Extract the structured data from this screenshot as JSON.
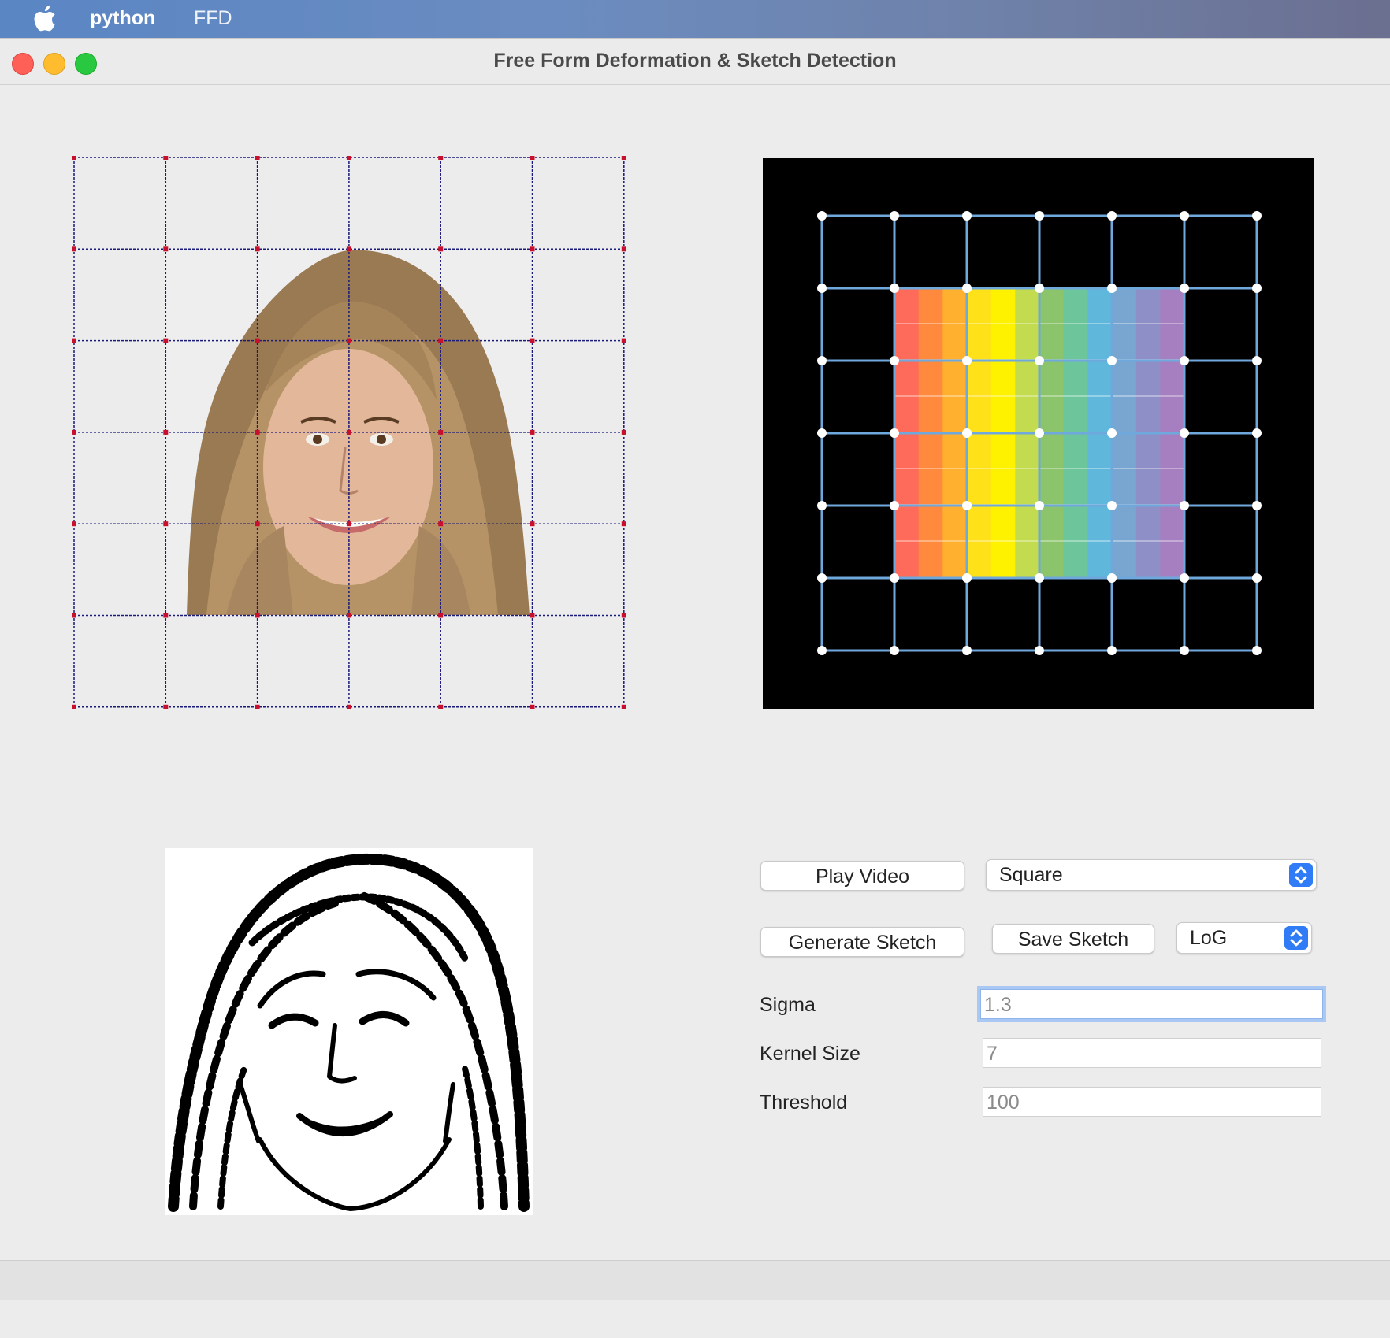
{
  "menubar": {
    "app_name": "python",
    "menu_item": "FFD"
  },
  "window": {
    "title": "Free Form Deformation & Sketch Detection"
  },
  "controls": {
    "play_video_label": "Play Video",
    "shape_select_value": "Square",
    "generate_sketch_label": "Generate Sketch",
    "save_sketch_label": "Save Sketch",
    "method_select_value": "LoG",
    "sigma": {
      "label": "Sigma",
      "placeholder": "1.3"
    },
    "kernel_size": {
      "label": "Kernel Size",
      "placeholder": "7"
    },
    "threshold": {
      "label": "Threshold",
      "placeholder": "100"
    }
  },
  "colors": {
    "ffd_grid_line": "#1a1a7a",
    "ffd_control_point": "#c8102e",
    "color_grid_line": "#6fa8dc",
    "color_control_point": "#ffffff",
    "accent": "#2f7cf6",
    "rainbow": [
      "#ff6b5a",
      "#ff8a3d",
      "#ffb02e",
      "#ffe11a",
      "#fff200",
      "#c2db4f",
      "#8bc46a",
      "#6cc59b",
      "#5fb8dc",
      "#79a6d0",
      "#8f8fc8",
      "#a57fbf"
    ]
  },
  "icons": {
    "apple": "apple-icon",
    "stepper": "up-down-chevron-icon"
  }
}
